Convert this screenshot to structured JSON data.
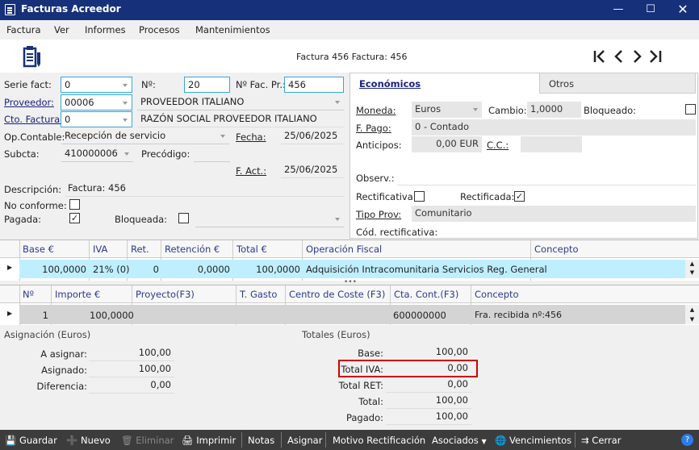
{
  "window": {
    "title": "Facturas Acreedor"
  },
  "menu": [
    "Factura",
    "Ver",
    "Informes",
    "Procesos",
    "Mantenimientos"
  ],
  "header": {
    "caption": "Factura 456  Factura: 456"
  },
  "form": {
    "serie_label": "Serie fact:",
    "serie_value": "0",
    "no_label": "Nº:",
    "no_value": "20",
    "nofacpr_label": "Nº Fac. Pr.:",
    "nofacpr_value": "456",
    "proveedor_label": "Proveedor:",
    "proveedor_value": "00006",
    "proveedor_name": "PROVEEDOR ITALIANO",
    "razon_social": "RAZÓN SOCIAL PROVEEDOR ITALIANO",
    "cto_label": "Cto. Factura:",
    "cto_value": "0",
    "opcont_label": "Op.Contable:",
    "opcont_value": "Recepción de servicio",
    "fecha_label": "Fecha:",
    "fecha_value": "25/06/2025",
    "subcta_label": "Subcta:",
    "subcta_value": "410000006",
    "precod_label": "Precódigo:",
    "fact_label": "F. Act.:",
    "fact_value": "25/06/2025",
    "desc_label": "Descripción:",
    "desc_value": "Factura: 456",
    "noconf_label": "No conforme:",
    "pagada_label": "Pagada:",
    "pagada_checked": "✓",
    "bloq_label": "Bloqueada:"
  },
  "tabs": {
    "economicos": "Económicos",
    "otros": "Otros"
  },
  "econ": {
    "moneda_label": "Moneda:",
    "moneda_value": "Euros",
    "cambio_label": "Cambio:",
    "cambio_value": "1,0000",
    "bloqueado_label": "Bloqueado:",
    "fpago_label": "F. Pago:",
    "fpago_value": "0 - Contado",
    "anticipos_label": "Anticipos:",
    "anticipos_value": "0,00 EUR",
    "cc_label": "C.C.:",
    "observ_label": "Observ.:",
    "rectificativa_label": "Rectificativa:",
    "rectificada_label": "Rectificada:",
    "rectificada_checked": "✓",
    "tipoprov_label": "Tipo Prov:",
    "tipoprov_value": "Comunitario",
    "codrect_label": "Cód. rectificativa:"
  },
  "grid1": {
    "headers": [
      "Base €",
      "IVA",
      "Ret.",
      "Retención €",
      "Total €",
      "Operación Fiscal",
      "Concepto"
    ],
    "row": [
      "100,0000",
      "21% (0)",
      "0",
      "0,0000",
      "100,0000",
      "Adquisición Intracomunitaria Servicios Reg. General",
      ""
    ]
  },
  "grid2": {
    "headers": [
      "Nº",
      "Importe €",
      "Proyecto(F3)",
      "T. Gasto",
      "Centro de Coste (F3)",
      "Cta. Cont.(F3)",
      "Concepto"
    ],
    "row": [
      "1",
      "100,0000",
      "",
      "",
      "",
      "600000000",
      "Fra. recibida nº:456"
    ]
  },
  "asignacion": {
    "title": "Asignación (Euros)",
    "a_asignar_label": "A asignar:",
    "a_asignar": "100,00",
    "asignado_label": "Asignado:",
    "asignado": "100,00",
    "diferencia_label": "Diferencia:",
    "diferencia": "0,00"
  },
  "totales": {
    "title": "Totales (Euros)",
    "base_label": "Base:",
    "base": "100,00",
    "iva_label": "Total IVA:",
    "iva": "0,00",
    "ret_label": "Total RET:",
    "ret": "0,00",
    "total_label": "Total:",
    "total": "100,00",
    "pagado_label": "Pagado:",
    "pagado": "100,00"
  },
  "toolbar": {
    "guardar": "Guardar",
    "nuevo": "Nuevo",
    "eliminar": "Eliminar",
    "imprimir": "Imprimir",
    "notas": "Notas",
    "asignar": "Asignar",
    "motivo": "Motivo Rectificación",
    "asociados": "Asociados",
    "vencimientos": "Vencimientos",
    "cerrar": "Cerrar"
  },
  "colors": {
    "titlebar": "#16317a",
    "highlight": "#d00000",
    "row_selected": "#bfefff"
  }
}
